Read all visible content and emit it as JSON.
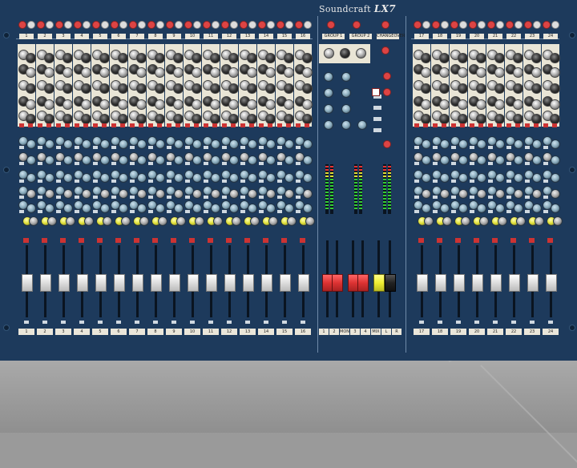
{
  "brand": {
    "name": "Soundcraft",
    "model": "LX7"
  },
  "left_channels": {
    "numbers": [
      "1",
      "2",
      "3",
      "4",
      "5",
      "6",
      "7",
      "8",
      "9",
      "10",
      "11",
      "12",
      "13",
      "14",
      "15",
      "16"
    ]
  },
  "right_channels": {
    "numbers": [
      "17",
      "18",
      "19",
      "20",
      "21",
      "22",
      "23",
      "24"
    ]
  },
  "master": {
    "top_labels": [
      "GROUP 1",
      "GROUP 2",
      "CHANGEOVER"
    ],
    "bottom_labels": [
      "1",
      "2",
      "MON",
      "3",
      "4",
      "MIX",
      "L",
      "R"
    ]
  },
  "colors": {
    "panel": "#1d3a5c",
    "cream": "#e9e5d6",
    "accent_red": "#cc3333",
    "accent_yellow": "#dddd33"
  }
}
